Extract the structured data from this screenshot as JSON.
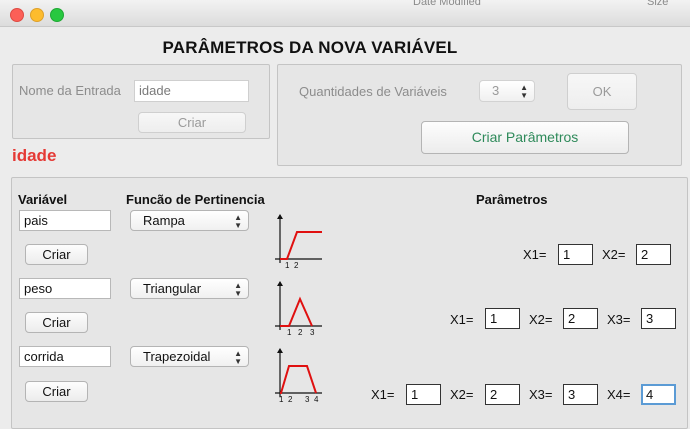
{
  "window": {
    "behind_col1": "Date Modified",
    "behind_col2": "Size",
    "title": "PARÂMETROS DA NOVA VARIÁVEL"
  },
  "entrada": {
    "label": "Nome da Entrada",
    "value": "idade",
    "criar_button": "Criar"
  },
  "quantidades": {
    "label": "Quantidades de Variáveis",
    "value": "3",
    "ok_button": "OK",
    "criar_parametros_button": "Criar Parâmetros"
  },
  "variable_name": "idade",
  "headers": {
    "variavel": "Variável",
    "funcao": "Funcão de Pertinencia",
    "parametros": "Parâmetros"
  },
  "rows": [
    {
      "name": "pais",
      "function": "Rampa",
      "criar_label": "Criar",
      "graph_ticks": [
        "1",
        "2"
      ],
      "params": [
        {
          "label": "X1=",
          "value": "1"
        },
        {
          "label": "X2=",
          "value": "2"
        }
      ]
    },
    {
      "name": "peso",
      "function": "Triangular",
      "criar_label": "Criar",
      "graph_ticks": [
        "1",
        "2",
        "3"
      ],
      "params": [
        {
          "label": "X1=",
          "value": "1"
        },
        {
          "label": "X2=",
          "value": "2"
        },
        {
          "label": "X3=",
          "value": "3"
        }
      ]
    },
    {
      "name": "corrida",
      "function": "Trapezoidal",
      "criar_label": "Criar",
      "graph_ticks": [
        "1",
        "2",
        "3",
        "4"
      ],
      "params": [
        {
          "label": "X1=",
          "value": "1"
        },
        {
          "label": "X2=",
          "value": "2"
        },
        {
          "label": "X3=",
          "value": "3"
        },
        {
          "label": "X4=",
          "value": "4"
        }
      ]
    }
  ],
  "colors": {
    "accent_red": "#e53935",
    "graph_red": "#e01010",
    "green_text": "#2e8a5a",
    "focus_blue": "#5b9bd5"
  }
}
